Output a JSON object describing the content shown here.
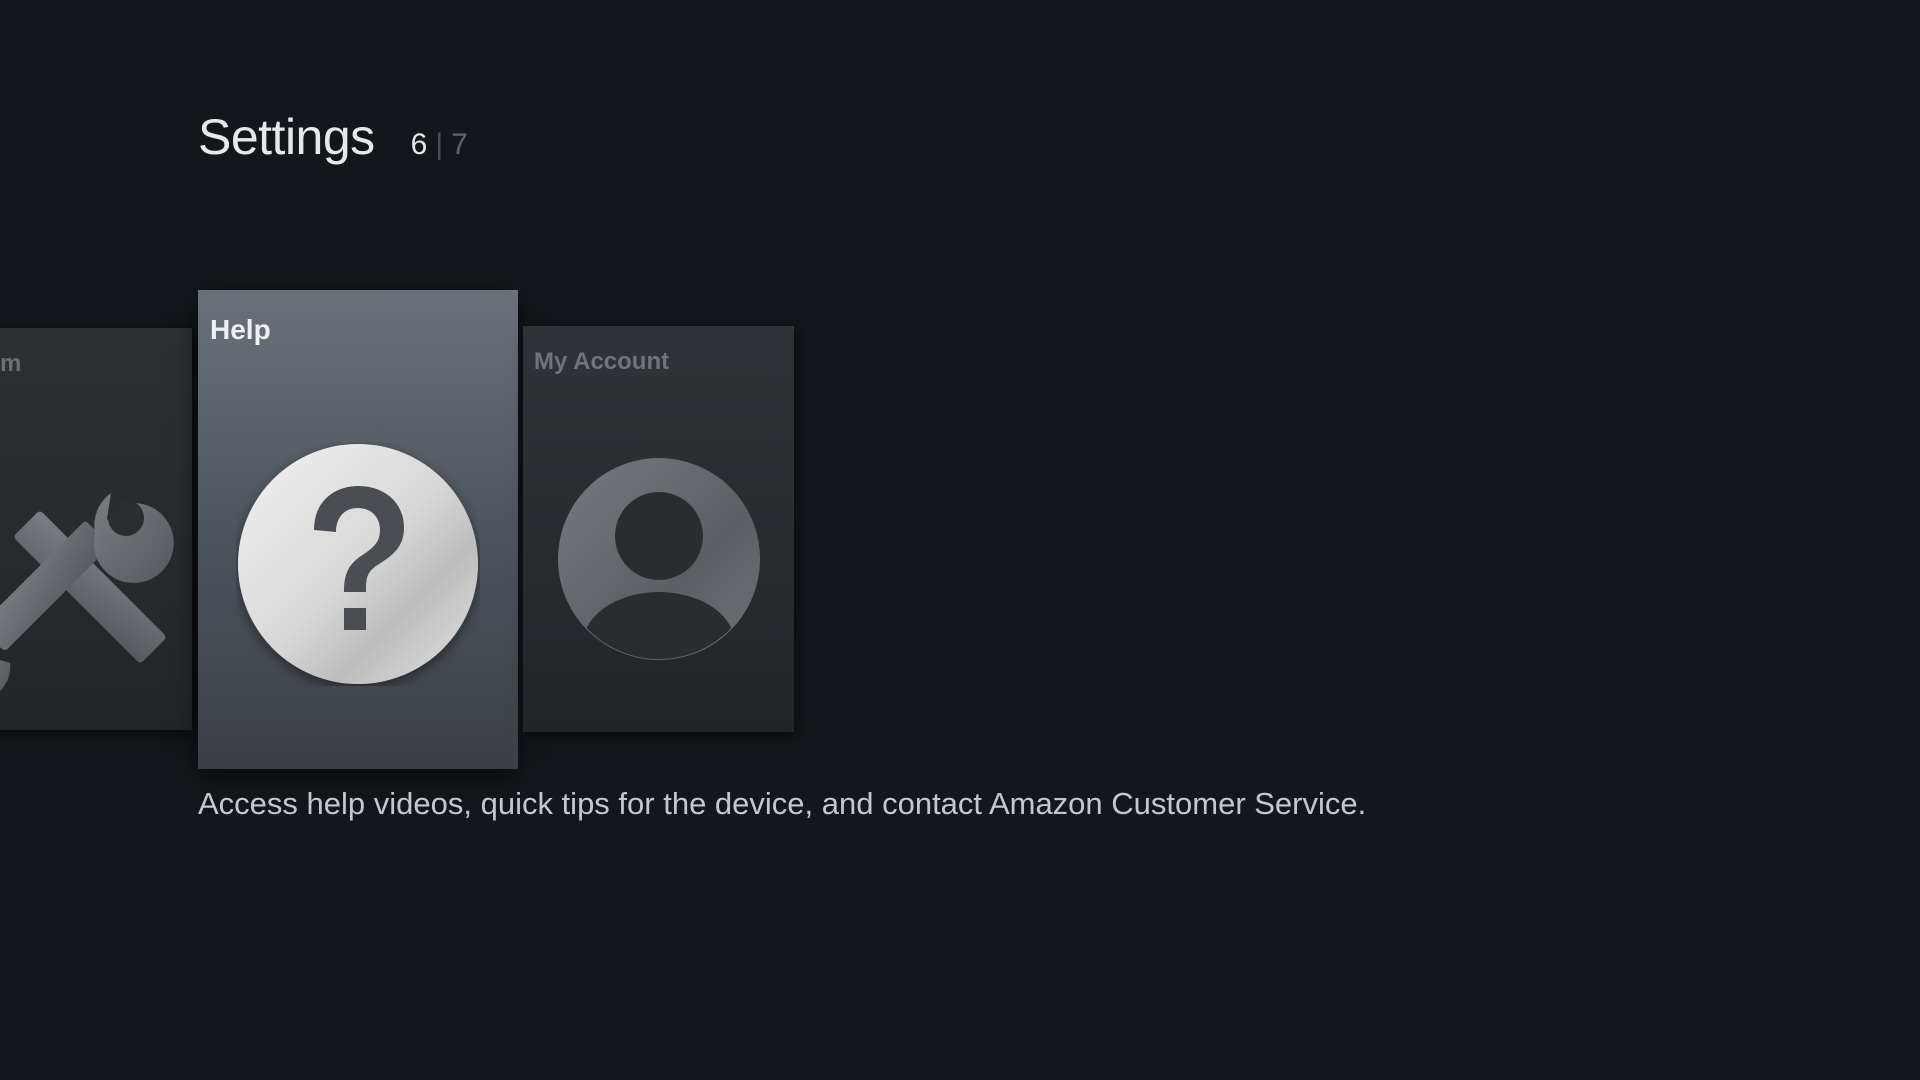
{
  "header": {
    "title": "Settings",
    "pager": {
      "current": "6",
      "separator": "|",
      "total": "7"
    }
  },
  "tiles": [
    {
      "label": "System",
      "visible_label": "m",
      "icon": "tools-icon",
      "state": "partial"
    },
    {
      "label": "Help",
      "icon": "help-question-icon",
      "state": "focused"
    },
    {
      "label": "My Account",
      "icon": "user-account-icon",
      "state": "normal"
    }
  ],
  "description": "Access help videos, quick tips for the device, and contact Amazon Customer Service.",
  "colors": {
    "background": "#13171b",
    "focused_tile_top": "#6b7178",
    "focused_tile_bottom": "#3c4046",
    "tile": "#2a2e31",
    "text_primary": "#e6e8ea",
    "text_muted": "#6f7479"
  }
}
